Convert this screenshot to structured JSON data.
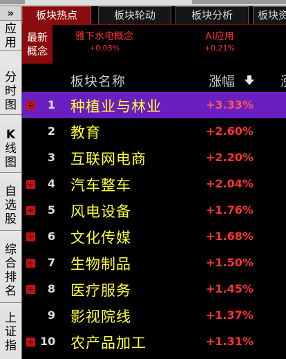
{
  "sidebar": {
    "expand_label": "»",
    "items": [
      {
        "id": "app",
        "chars": [
          "应",
          "用"
        ]
      },
      {
        "id": "minute-chart",
        "chars": [
          "分",
          "时",
          "图"
        ]
      },
      {
        "id": "kline-chart",
        "chars": [
          "K",
          "线",
          "图"
        ]
      },
      {
        "id": "watchlist",
        "chars": [
          "自",
          "选",
          "股"
        ]
      },
      {
        "id": "ranking",
        "chars": [
          "综",
          "合",
          "排",
          "名"
        ]
      },
      {
        "id": "sh-index",
        "chars": [
          "上",
          "证",
          "指"
        ]
      }
    ]
  },
  "tabs": [
    {
      "label": "板块热点",
      "active": true
    },
    {
      "label": "板块轮动",
      "active": false
    },
    {
      "label": "板块分析",
      "active": false
    },
    {
      "label": "板块资",
      "active": false
    }
  ],
  "latest": {
    "label_line1": "最新",
    "label_line2": "概念"
  },
  "tickers": [
    {
      "name": "雅下水电概念",
      "change": "+0.03%"
    },
    {
      "name": "AI应用",
      "change": "+0.21%"
    }
  ],
  "table": {
    "header_name": "板块名称",
    "header_change": "涨幅",
    "header_extra": "涨",
    "rows": [
      {
        "rank": "1",
        "name": "种植业与林业",
        "change": "+3.33%",
        "plus": true,
        "selected": true
      },
      {
        "rank": "2",
        "name": "教育",
        "change": "+2.60%",
        "plus": false,
        "selected": false
      },
      {
        "rank": "3",
        "name": "互联网电商",
        "change": "+2.20%",
        "plus": false,
        "selected": false
      },
      {
        "rank": "4",
        "name": "汽车整车",
        "change": "+2.04%",
        "plus": true,
        "selected": false
      },
      {
        "rank": "5",
        "name": "风电设备",
        "change": "+1.76%",
        "plus": true,
        "selected": false
      },
      {
        "rank": "6",
        "name": "文化传媒",
        "change": "+1.68%",
        "plus": true,
        "selected": false
      },
      {
        "rank": "7",
        "name": "生物制品",
        "change": "+1.50%",
        "plus": true,
        "selected": false
      },
      {
        "rank": "8",
        "name": "医疗服务",
        "change": "+1.45%",
        "plus": true,
        "selected": false
      },
      {
        "rank": "9",
        "name": "影视院线",
        "change": "+1.37%",
        "plus": false,
        "selected": false
      },
      {
        "rank": "10",
        "name": "农产品加工",
        "change": "+1.31%",
        "plus": true,
        "selected": false
      }
    ]
  },
  "colors": {
    "background": "#000000",
    "active_tab": "#8a0c0c",
    "selected_row": "#6a1fc0",
    "name_text": "#ffff33",
    "up_text": "#ff3333"
  }
}
